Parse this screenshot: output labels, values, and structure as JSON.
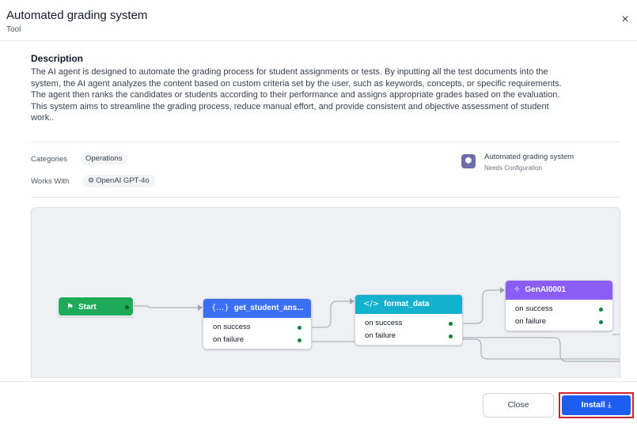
{
  "dialog": {
    "title": "Automated grading system",
    "subtitle": "Tool",
    "close_icon": "×"
  },
  "description": {
    "heading": "Description",
    "lines": [
      "The AI agent is designed to automate the grading process for student assignments or tests. By inputting all the test documents into the",
      "system, the AI agent analyzes the content based on custom criteria set by the user, such as keywords, concepts, or specific requirements.",
      "The agent then ranks the candidates or students according to their performance and assigns appropriate grades based on the evaluation.",
      "This system aims to streamline the grading process, reduce manual effort, and provide consistent and objective assessment of student",
      "work.."
    ]
  },
  "meta": {
    "categories_label": "Categories",
    "category": "Operations",
    "works_with_label": "Works With",
    "works_with_icon": "openai-icon",
    "works_with": "OpenAI GPT-4o"
  },
  "tool_card": {
    "icon": "box-icon",
    "name": "Automated grading system",
    "status": "Needs Configuration"
  },
  "workflow": {
    "start": {
      "label": "Start",
      "icon": "flag-icon",
      "color": "#1faa59"
    },
    "nodes": [
      {
        "label": "get_student_ans...",
        "icon": "variable-braces-icon",
        "color": "#3b6ff5",
        "on_success": "on success",
        "on_failure": "on failure"
      },
      {
        "label": "format_data",
        "icon": "code-icon",
        "color": "#14b1cf",
        "on_success": "on success",
        "on_failure": "on failure"
      },
      {
        "label": "GenAI0001",
        "icon": "sparkle-icon",
        "color": "#8b5cf6",
        "on_success": "on success",
        "on_failure": "on failure"
      }
    ]
  },
  "footer": {
    "close_label": "Close",
    "install_label": "Install",
    "install_icon": "download-icon"
  },
  "colors": {
    "primary": "#1d5ef0",
    "highlight_border": "#d2222d",
    "connector_dot": "#15803d"
  }
}
